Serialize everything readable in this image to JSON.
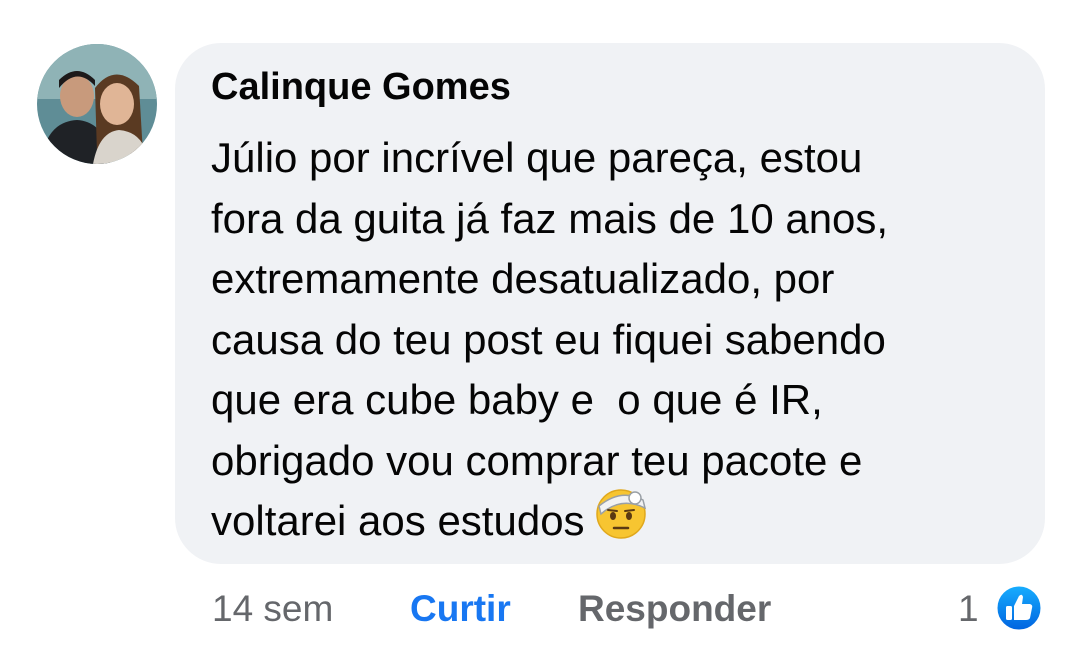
{
  "comment": {
    "author": "Calinque Gomes",
    "lines": [
      "Júlio por incrível que pareça, estou",
      "fora da guita já faz mais de 10 anos,",
      "extremamente desatualizado, por",
      "causa do teu post eu fiquei sabendo",
      "que era cube baby e  o que é IR,",
      "obrigado vou comprar teu pacote e",
      "voltarei aos estudos"
    ],
    "emoji": "face-with-head-bandage-icon"
  },
  "footer": {
    "time": "14 sem",
    "like_label": "Curtir",
    "reply_label": "Responder",
    "reaction_count": "1",
    "reaction_icon": "thumbs-up-icon"
  },
  "colors": {
    "bubble": "#f0f2f5",
    "text": "#050505",
    "muted": "#65676b",
    "accent": "#1877f2"
  }
}
